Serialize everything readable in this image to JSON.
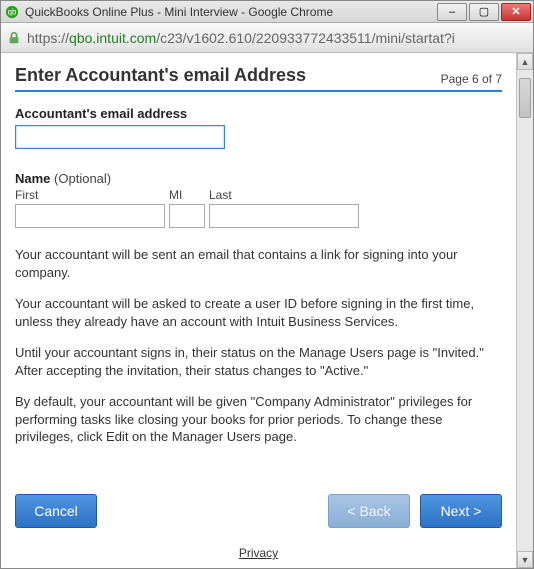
{
  "window": {
    "title": "QuickBooks Online Plus - Mini Interview - Google Chrome"
  },
  "address": {
    "scheme": "https://",
    "host": "qbo.intuit.com",
    "path": "/c23/v1602.610/220933772433511/mini/startat?i"
  },
  "heading": {
    "title": "Enter Accountant's email Address",
    "page_indicator": "Page 6 of 7"
  },
  "form": {
    "email_label": "Accountant's email address",
    "email_value": "",
    "name_label": "Name",
    "name_optional": "(Optional)",
    "first_label": "First",
    "first_value": "",
    "mi_label": "MI",
    "mi_value": "",
    "last_label": "Last",
    "last_value": ""
  },
  "paragraphs": {
    "p1": "Your accountant will be sent an email that contains a link for signing into your company.",
    "p2": "Your accountant will be asked to create a user ID before signing in the first time, unless they already have an account with Intuit Business Services.",
    "p3": "Until your accountant signs in, their status on the Manage Users page is \"Invited.\" After accepting the invitation, their status changes to \"Active.\"",
    "p4": "By default, your accountant will be given \"Company Administrator\" privileges for performing tasks like closing your books for prior periods. To change these privileges, click Edit on the Manager Users page."
  },
  "buttons": {
    "cancel": "Cancel",
    "back": "< Back",
    "next": "Next >"
  },
  "footer": {
    "privacy": "Privacy"
  }
}
